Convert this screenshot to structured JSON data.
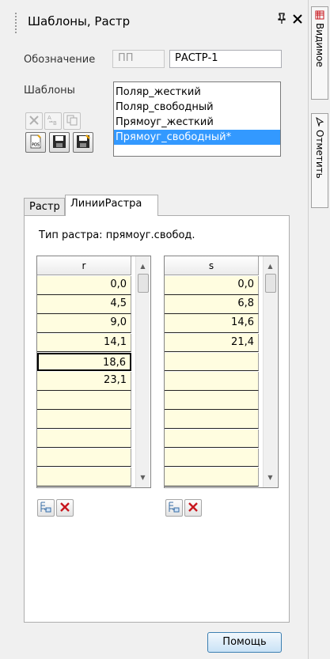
{
  "panel": {
    "title": "Шаблоны, Растр",
    "pin": "ᵖ",
    "close": "✕"
  },
  "designation": {
    "label": "Обозначение",
    "prefix": "ПП",
    "value": "РАСТР-1"
  },
  "templates": {
    "label": "Шаблоны",
    "items": [
      "Поляр_жесткий",
      "Поляр_свободный",
      "Прямоуг_жесткий",
      "Прямоуг_свободный*"
    ],
    "selected_index": 3
  },
  "tabs": [
    "Растр",
    "ЛинииРастра"
  ],
  "active_tab": 1,
  "raster_type": "Тип растра: прямоуг.свобод.",
  "grid_r": {
    "header": "r",
    "values": [
      "0,0",
      "4,5",
      "9,0",
      "14,1",
      "18,6",
      "23,1",
      "",
      "",
      "",
      "",
      ""
    ],
    "focus_index": 4
  },
  "grid_s": {
    "header": "s",
    "values": [
      "0,0",
      "6,8",
      "14,6",
      "21,4",
      "",
      "",
      "",
      "",
      "",
      "",
      ""
    ]
  },
  "help_button": "Помощь",
  "sidebar": {
    "tabs": [
      "Видимое",
      "Отметить"
    ]
  },
  "icons": {
    "delete": "delete-icon",
    "rename": "rename-icon",
    "copy": "copy-icon",
    "import": "import-pos-icon",
    "save": "save-icon",
    "save_as": "save-as-icon",
    "add_row": "add-row-icon",
    "delete_row": "delete-row-icon",
    "visible": "grid-icon",
    "mark": "cursor-icon"
  },
  "colors": {
    "selection": "#3399ff",
    "cell_bg": "#fffde0",
    "delete_red": "#c8171e"
  }
}
